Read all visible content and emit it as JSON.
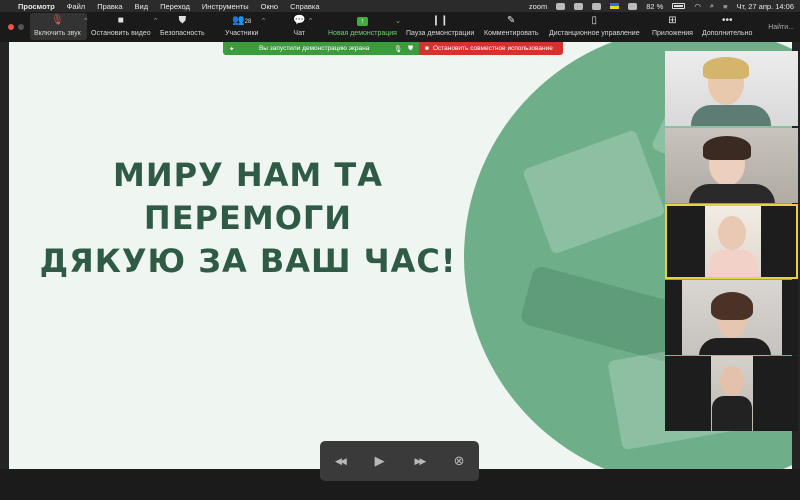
{
  "menubar": {
    "app_name": "Просмотр",
    "items": [
      "Файл",
      "Правка",
      "Вид",
      "Переход",
      "Инструменты",
      "Окно",
      "Справка"
    ],
    "zoom_label": "zoom",
    "battery": "82 %",
    "datetime": "Чт, 27 апр.  14:06"
  },
  "toolbar": {
    "unmute": "Включить звук",
    "stop_video": "Остановить видео",
    "security": "Безопасность",
    "participants": "Участники",
    "participants_count": "28",
    "chat": "Чат",
    "new_share": "Новая демонстрация",
    "pause_share": "Пауза демонстрации",
    "annotate": "Комментировать",
    "remote_control": "Дистанционное управление",
    "apps": "Приложения",
    "more": "Дополнительно",
    "search": "Найти..."
  },
  "banner": {
    "message": "Вы запустили демонстрацию экрана",
    "stop_share": "Остановить совместное использование"
  },
  "slide": {
    "line1": "МИРУ НАМ ТА",
    "line2": "ПЕРЕМОГИ",
    "line3": "ДЯКУЮ ЗА ВАШ ЧАС!"
  },
  "colors": {
    "slide_bg": "#eff5f0",
    "circle": "#6eaf8a",
    "title_text": "#2f5a46",
    "banner_green": "#3b9c3b",
    "banner_red": "#d4322c",
    "active_speaker": "#e9d23c"
  },
  "icons": {
    "prev": "◀◀",
    "play": "▶",
    "next": "▶▶",
    "close": "⊗"
  }
}
